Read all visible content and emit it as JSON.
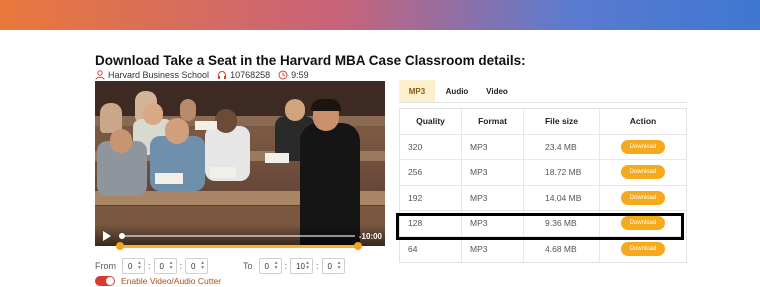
{
  "page": {
    "title": "Download Take a Seat in the Harvard MBA Case Classroom details:",
    "author": "Harvard Business School",
    "listens": "10768258",
    "duration": "9:59"
  },
  "player": {
    "time_remaining": "-10:00"
  },
  "cutter": {
    "from_label": "From",
    "to_label": "To",
    "from": [
      "0",
      "0",
      "0"
    ],
    "to": [
      "0",
      "10",
      "0"
    ],
    "toggle_label": "Enable Video/Audio Cutter"
  },
  "tabs": [
    {
      "label": "MP3",
      "active": true
    },
    {
      "label": "Audio",
      "active": false
    },
    {
      "label": "Video",
      "active": false
    }
  ],
  "table": {
    "headers": [
      "Quality",
      "Format",
      "File size",
      "Action"
    ],
    "rows": [
      {
        "quality": "320",
        "format": "MP3",
        "size": "23.4 MB",
        "action": "Download"
      },
      {
        "quality": "256",
        "format": "MP3",
        "size": "18.72 MB",
        "action": "Download"
      },
      {
        "quality": "192",
        "format": "MP3",
        "size": "14.04 MB",
        "action": "Download"
      },
      {
        "quality": "128",
        "format": "MP3",
        "size": "9.36 MB",
        "action": "Download"
      },
      {
        "quality": "64",
        "format": "MP3",
        "size": "4.68 MB",
        "action": "Download"
      }
    ]
  },
  "colors": {
    "accent": "#f5a91d",
    "toggle": "#d63c2d",
    "gradient_start": "#e9783c",
    "gradient_end": "#3f77d1"
  },
  "icons": [
    "user-icon",
    "headphones-icon",
    "clock-icon",
    "play-icon"
  ]
}
